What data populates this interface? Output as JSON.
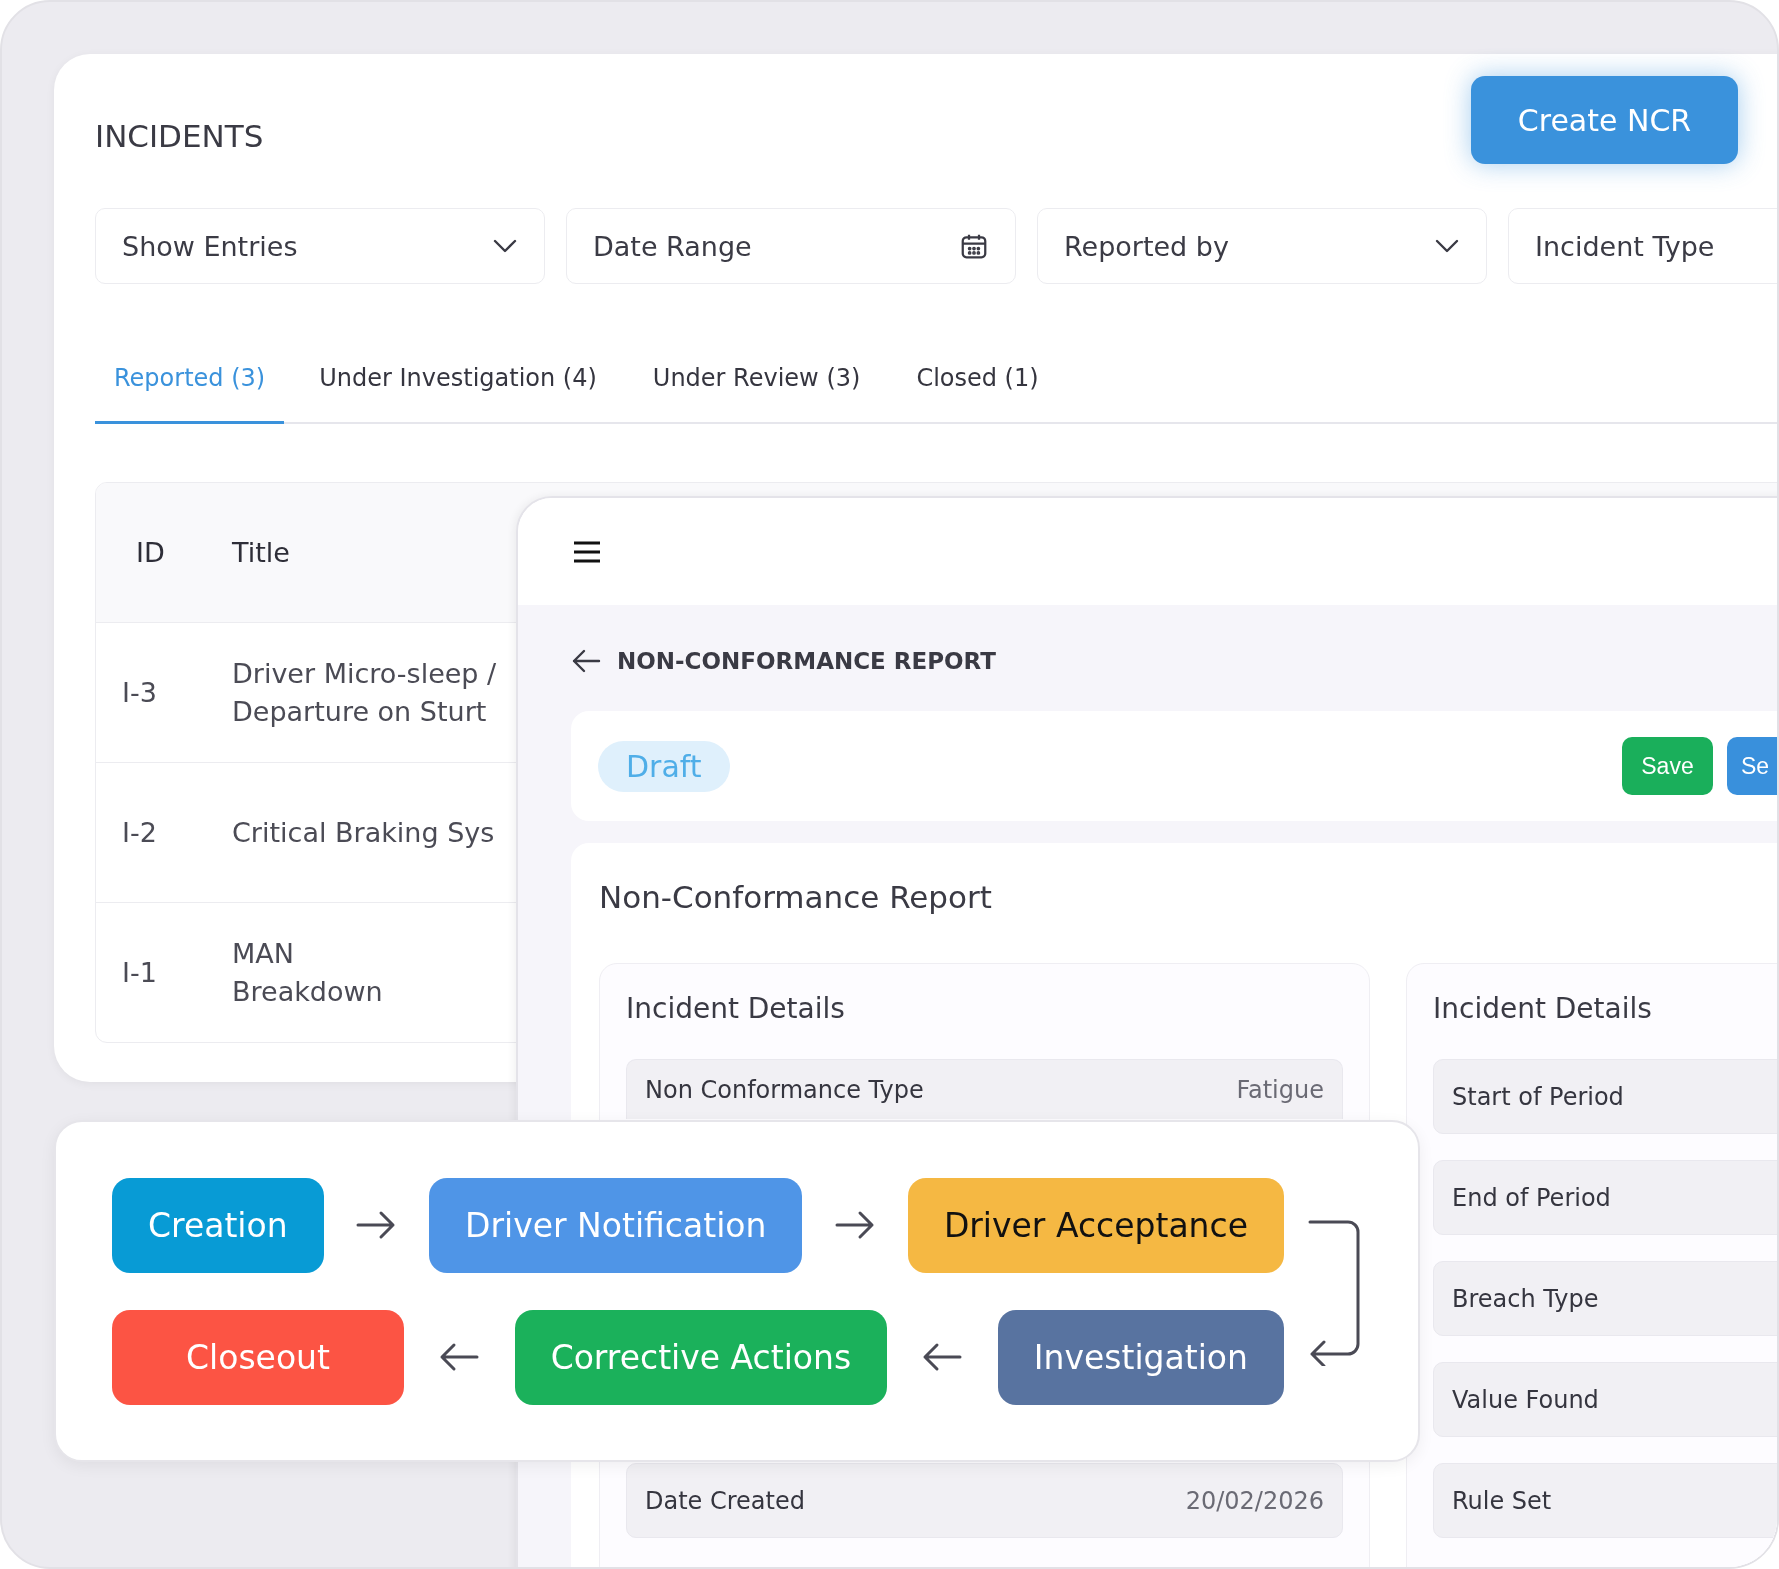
{
  "incidents": {
    "title": "INCIDENTS",
    "create_button": "Create NCR",
    "filters": [
      {
        "kind": "dropdown",
        "label": "Show Entries"
      },
      {
        "kind": "date",
        "label": "Date Range"
      },
      {
        "kind": "dropdown",
        "label": "Reported by"
      },
      {
        "kind": "dropdown",
        "label": "Incident Type"
      }
    ],
    "tabs": [
      {
        "label": "Reported (3)",
        "selected": true
      },
      {
        "label": "Under Investigation (4)",
        "selected": false
      },
      {
        "label": "Under Review (3)",
        "selected": false
      },
      {
        "label": "Closed (1)",
        "selected": false
      }
    ],
    "table": {
      "columns": [
        "ID",
        "Title"
      ],
      "rows": [
        {
          "id": "I-3",
          "title": "Driver Micro-sleep /\nDeparture on Sturt"
        },
        {
          "id": "I-2",
          "title": "Critical Braking Sys"
        },
        {
          "id": "I-1",
          "title": "MAN\nBreakdown"
        }
      ]
    }
  },
  "ncr": {
    "heading": "NON-CONFORMANCE REPORT",
    "status": "Draft",
    "buttons": [
      {
        "label": "Save",
        "color": "#1aaf5b"
      },
      {
        "label": "Se",
        "color": "#3990dc"
      }
    ],
    "title": "Non-Conformance Report",
    "left_section": {
      "title": "Incident Details",
      "fields": [
        {
          "label": "Non Conformance Type",
          "value": "Fatigue"
        },
        {
          "label": "Date Created",
          "value": "20/02/2026"
        }
      ]
    },
    "right_section": {
      "title": "Incident Details",
      "fields": [
        {
          "label": "Start of Period"
        },
        {
          "label": "End of Period"
        },
        {
          "label": "Breach Type"
        },
        {
          "label": "Value Found"
        },
        {
          "label": "Rule Set"
        }
      ]
    }
  },
  "workflow": {
    "stages": [
      {
        "label": "Creation",
        "color": "#089bd5"
      },
      {
        "label": "Driver Notification",
        "color": "#4f95e7"
      },
      {
        "label": "Driver Acceptance",
        "color": "#f5b843"
      },
      {
        "label": "Closeout",
        "color": "#fc5444"
      },
      {
        "label": "Corrective Actions",
        "color": "#1bb15b"
      },
      {
        "label": "Investigation",
        "color": "#5873a0"
      }
    ]
  }
}
